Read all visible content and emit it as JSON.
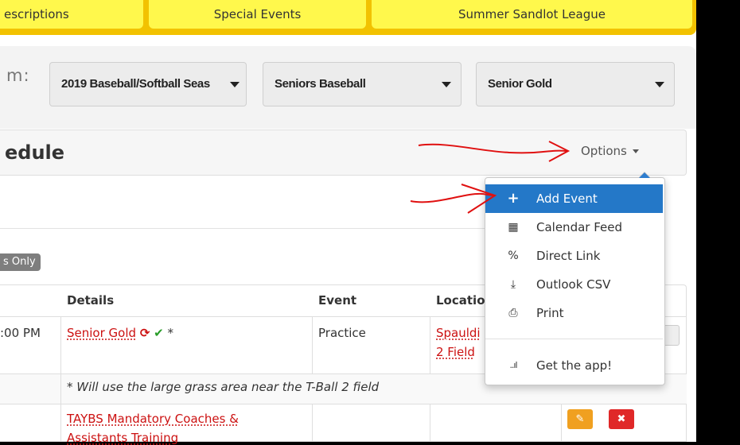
{
  "nav": {
    "tabs": [
      {
        "label": "escriptions"
      },
      {
        "label": "Special Events"
      },
      {
        "label": "Summer Sandlot League"
      }
    ]
  },
  "filters": {
    "label": "m:",
    "season": "2019 Baseball/Softball Seas",
    "division": "Seniors Baseball",
    "team": "Senior Gold"
  },
  "schedule": {
    "title": "edule",
    "options_label": "Options"
  },
  "badge": "s Only",
  "table": {
    "headers": [
      "Details",
      "Event",
      "Locatio"
    ],
    "rows": [
      {
        "time": ":00 PM",
        "details": "Senior Gold",
        "details_suffix": "*",
        "event": "Practice",
        "location_line1": "Spauldi",
        "location_line2": "2 Field"
      }
    ],
    "note": "* Will use the large grass area near the T-Ball 2 field",
    "row2": {
      "details_line1": "TAYBS Mandatory Coaches &",
      "details_line2": "Assistants Training"
    }
  },
  "menu": {
    "items": [
      {
        "label": "Add Event",
        "icon": "plus-icon",
        "glyph": "+"
      },
      {
        "label": "Calendar Feed",
        "icon": "calendar-icon",
        "glyph": "▦"
      },
      {
        "label": "Direct Link",
        "icon": "link-icon",
        "glyph": "%"
      },
      {
        "label": "Outlook CSV",
        "icon": "download-icon",
        "glyph": "⤓"
      },
      {
        "label": "Print",
        "icon": "print-icon",
        "glyph": "⎙"
      },
      {
        "label": "Get the app!",
        "icon": "signal-icon",
        "glyph": "..ıl"
      }
    ]
  },
  "colors": {
    "nav_bg": "#f2c200",
    "nav_tab": "#fff84c",
    "menu_active": "#2478c8",
    "link_red": "#cc1111",
    "annotation_red": "#e01010",
    "check_green": "#2a9d2a"
  }
}
